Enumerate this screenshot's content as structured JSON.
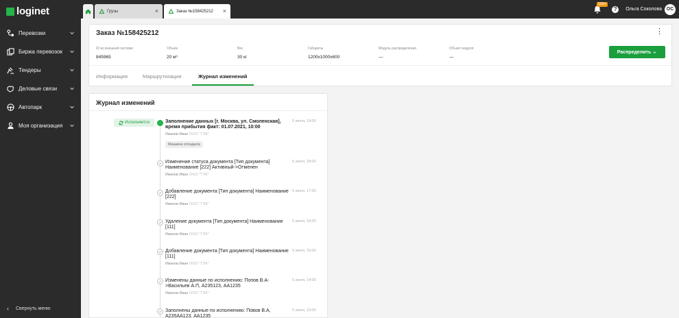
{
  "brand": {
    "name": "loginet",
    "color": "#25b34b"
  },
  "sidebar": {
    "items": [
      {
        "label": "Перевозки",
        "icon": "route-icon"
      },
      {
        "label": "Биржа перевозок",
        "icon": "exchange-icon"
      },
      {
        "label": "Тендеры",
        "icon": "gavel-icon"
      },
      {
        "label": "Деловые связи",
        "icon": "handshake-icon"
      },
      {
        "label": "Автопарк",
        "icon": "steering-wheel-icon"
      },
      {
        "label": "Моя организация",
        "icon": "organization-icon"
      }
    ],
    "collapse_label": "Свернуть меню"
  },
  "topbar": {
    "tabs": [
      {
        "label": "Грузы"
      },
      {
        "label": "Заказ №158425212"
      }
    ],
    "notifications_badge": "100+",
    "user_name": "Ольга Соколова",
    "user_initials": "ОС"
  },
  "order": {
    "title": "Заказ №158425212",
    "fields": [
      {
        "label": "ID во внешней системе",
        "value": "845965"
      },
      {
        "label": "Объем",
        "value": "20 м³"
      },
      {
        "label": "Вес",
        "value": "30 кг"
      },
      {
        "label": "Габариты",
        "value": "1200x1000x600"
      },
      {
        "label": "Модуль распределения",
        "value": "—"
      },
      {
        "label": "Объект модуля",
        "value": "—"
      }
    ],
    "distribute_label": "Распределить",
    "tabs": [
      {
        "label": "Информация",
        "active": false
      },
      {
        "label": "Маршрутизация",
        "active": false
      },
      {
        "label": "Журнал изменений",
        "active": true
      }
    ]
  },
  "log": {
    "title": "Журнал изменений",
    "status": "Исполняется",
    "events": [
      {
        "text": "Заполнение данных [г. Москва, ул. Смоленская], время прибытия факт: 01.07.2021, 10:00",
        "author": "Иванов Иван",
        "org": "ООО \"ТЭК\"",
        "time": "5 июля, 19:00",
        "tag": "Машина опоздала"
      },
      {
        "text": "Изменение статуса документа [Тип документа] Наименование [222] Активный->Отменен",
        "author": "Иванов Иван",
        "org": "ООО \"ТЭК\"",
        "time": "5 июля, 18:00"
      },
      {
        "text": "Добавление документа [Тип документа] Наименование [222]",
        "author": "Иванов Иван",
        "org": "ООО \"ТЭК\"",
        "time": "5 июля, 17:00"
      },
      {
        "text": "Удаление документа [Тип документа] Наименование [111]",
        "author": "Иванов Иван",
        "org": "ООО \"ТЭК\"",
        "time": "5 июля, 16:00"
      },
      {
        "text": "Добавление документа [Тип документа] Наименование [111]",
        "author": "Иванов Иван",
        "org": "ООО \"ТЭК\"",
        "time": "5 июля, 15:00"
      },
      {
        "text": "Изменены данные по исполнению: Попов В.А->Васильев А.П, А235123, АА1235",
        "author": "Иванов Иван",
        "org": "ООО \"ТЭК\"",
        "time": "5 июля, 14:00"
      },
      {
        "text": "Заполнены данные по исполнению: Повов В.А, А235АА123, АА1235",
        "author": "",
        "org": "",
        "time": "5 июля, 13:00"
      }
    ]
  }
}
